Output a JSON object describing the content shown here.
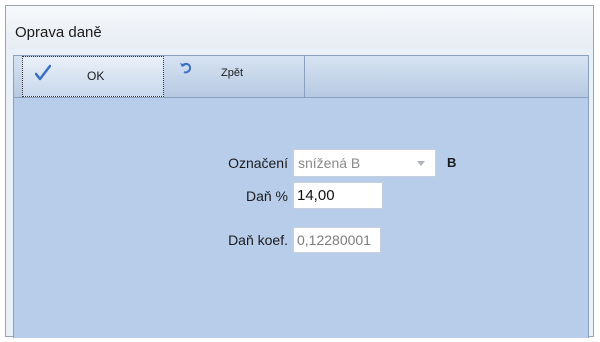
{
  "window": {
    "title": "Oprava daně"
  },
  "toolbar": {
    "ok_label": "OK",
    "back_label": "Zpět",
    "ok_icon": "checkmark-icon",
    "back_icon": "undo-icon"
  },
  "form": {
    "designation": {
      "label": "Označení",
      "value": "snížená B",
      "code": "B"
    },
    "tax_percent": {
      "label": "Daň %",
      "value": "14,00"
    },
    "tax_coef": {
      "label": "Daň koef.",
      "value": "0,12280001"
    }
  },
  "colors": {
    "toolbar": "#c7d6ea",
    "panel": "#b8cdea",
    "accent": "#3a6fc4"
  }
}
